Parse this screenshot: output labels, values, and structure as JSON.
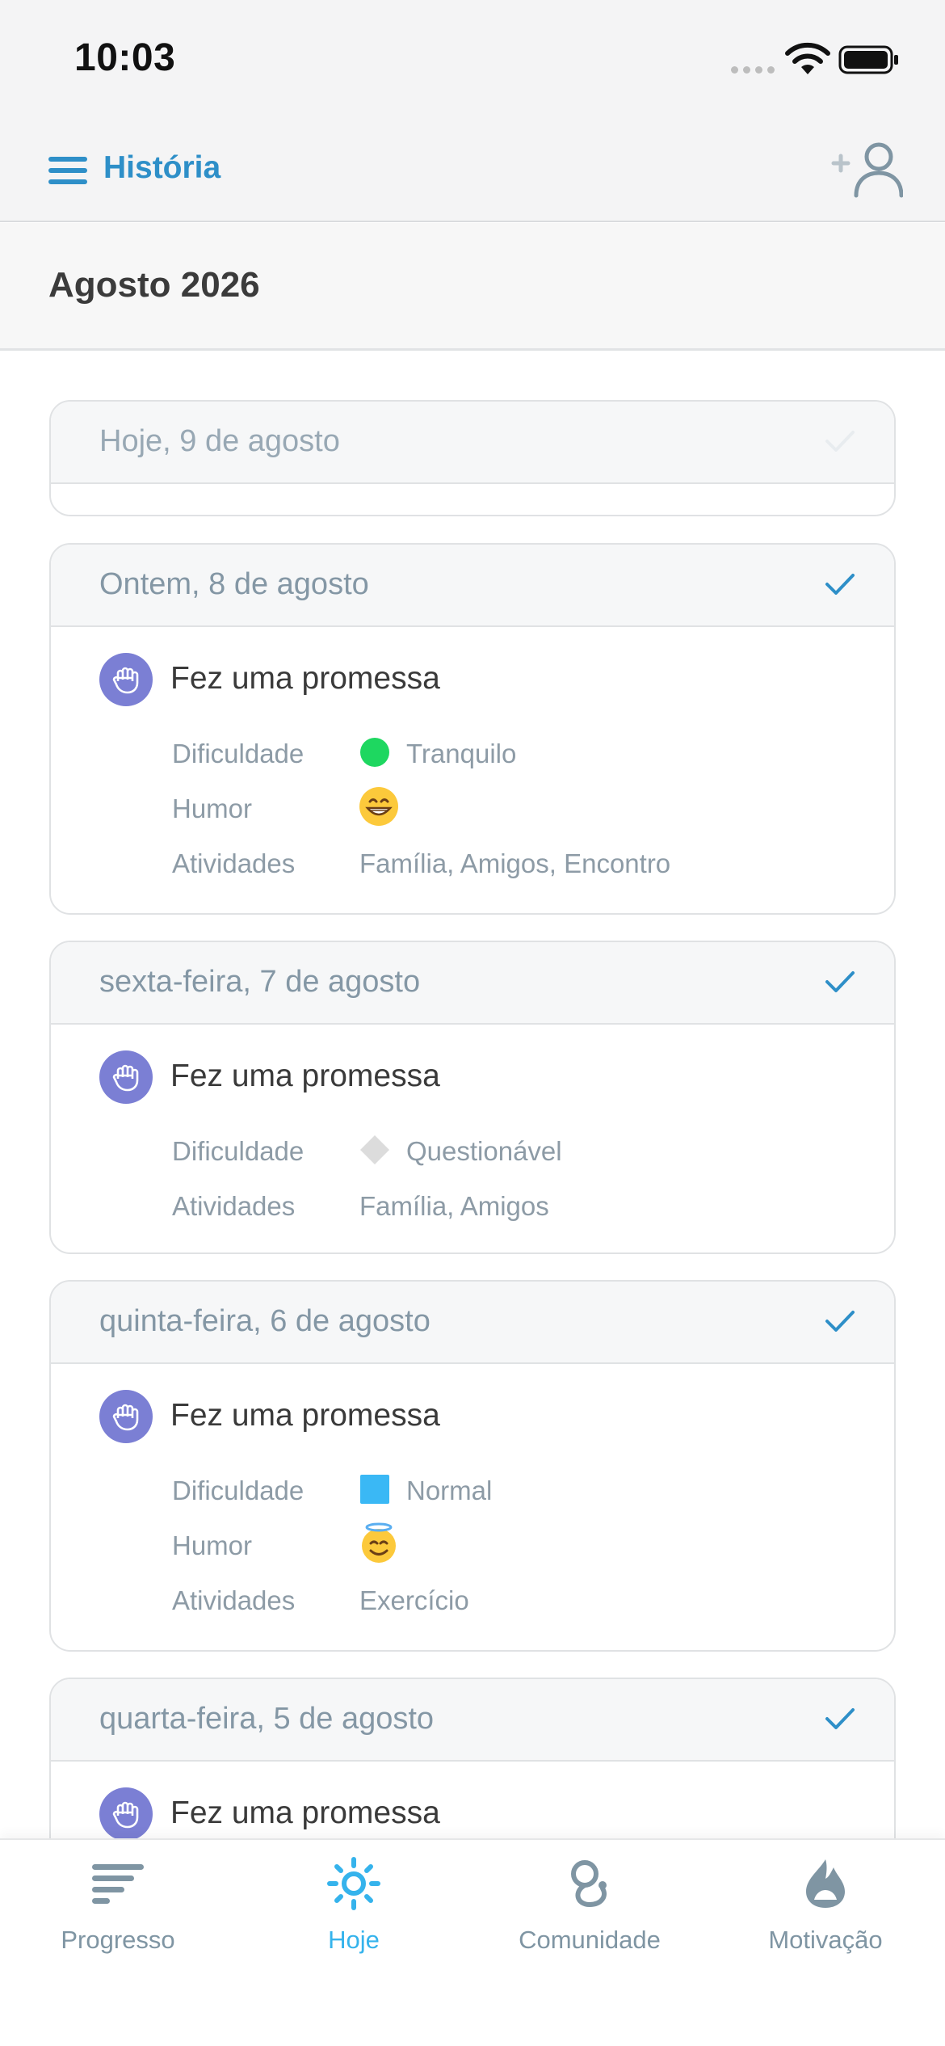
{
  "status_bar": {
    "time": "10:03"
  },
  "header": {
    "title": "História"
  },
  "month": {
    "title": "Agosto 2026"
  },
  "cards": [
    {
      "date": "Hoje, 9 de agosto"
    },
    {
      "date": "Ontem, 8 de agosto",
      "entry": "Fez uma promessa",
      "labels": {
        "difficulty": "Dificuldade",
        "mood": "Humor",
        "activities": "Atividades"
      },
      "difficulty": "Tranquilo",
      "activities": "Família, Amigos, Encontro"
    },
    {
      "date": "sexta-feira, 7 de agosto",
      "entry": "Fez uma promessa",
      "labels": {
        "difficulty": "Dificuldade",
        "activities": "Atividades"
      },
      "difficulty": "Questionável",
      "activities": "Família, Amigos"
    },
    {
      "date": "quinta-feira, 6 de agosto",
      "entry": "Fez uma promessa",
      "labels": {
        "difficulty": "Dificuldade",
        "mood": "Humor",
        "activities": "Atividades"
      },
      "difficulty": "Normal",
      "activities": "Exercício"
    },
    {
      "date": "quarta-feira, 5 de agosto",
      "entry": "Fez uma promessa"
    }
  ],
  "tabs": [
    {
      "label": "Progresso",
      "icon": "progress-icon"
    },
    {
      "label": "Hoje",
      "icon": "sun-icon",
      "active": true
    },
    {
      "label": "Comunidade",
      "icon": "community-icon"
    },
    {
      "label": "Motivação",
      "icon": "motivation-icon"
    }
  ],
  "colors": {
    "accent": "#2e8fc8",
    "active_tab": "#35b3ec",
    "badge": "#7b7fd4",
    "tranquilo": "#1ed760",
    "questionavel": "#dcdcdc",
    "normal": "#3ab8f5"
  }
}
